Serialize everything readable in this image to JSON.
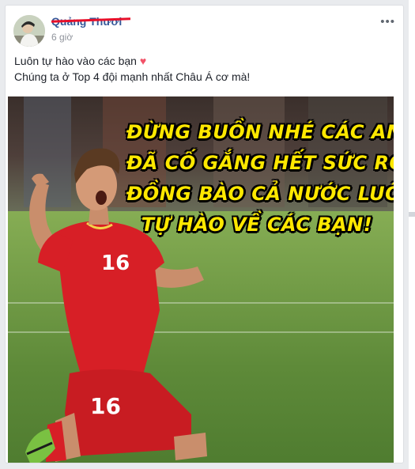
{
  "post": {
    "author": "Quảng Thươi",
    "time": "6 giờ",
    "more_icon": "•••",
    "lines": [
      "Luôn tự hào vào các bạn",
      "Chúng ta ở Top 4 đội mạnh nhất Châu Á cơ mà!"
    ],
    "heart": "♥"
  },
  "photo": {
    "caption": [
      "ĐỪNG BUỒN NHÉ CÁC ANH",
      "ĐÃ CỐ GẮNG HẾT SỨC RỒI",
      "ĐỒNG BÀO CẢ NƯỚC LUÔN",
      "TỰ HÀO VỀ CÁC BẠN!"
    ],
    "jersey_number": "16",
    "shorts_number": "16"
  },
  "colors": {
    "author_link": "#365899",
    "caption_yellow": "#ffe800",
    "jersey_red": "#d71f26",
    "redaction": "#e8102a"
  }
}
